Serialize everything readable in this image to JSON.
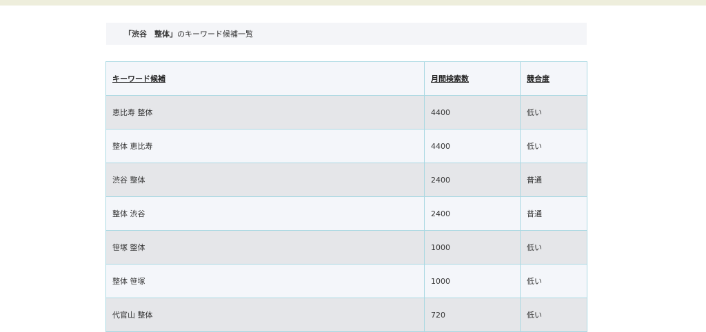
{
  "heading": {
    "keyword_quoted": "「渋谷　整体」",
    "suffix": "のキーワード候補一覧"
  },
  "table": {
    "headers": [
      "キーワード候補",
      "月間検索数",
      "競合度"
    ],
    "rows": [
      [
        "恵比寿 整体",
        "4400",
        "低い"
      ],
      [
        "整体 恵比寿",
        "4400",
        "低い"
      ],
      [
        "渋谷 整体",
        "2400",
        "普通"
      ],
      [
        "整体 渋谷",
        "2400",
        "普通"
      ],
      [
        "笹塚 整体",
        "1000",
        "低い"
      ],
      [
        "整体 笹塚",
        "1000",
        "低い"
      ],
      [
        "代官山 整体",
        "720",
        "低い"
      ]
    ]
  }
}
